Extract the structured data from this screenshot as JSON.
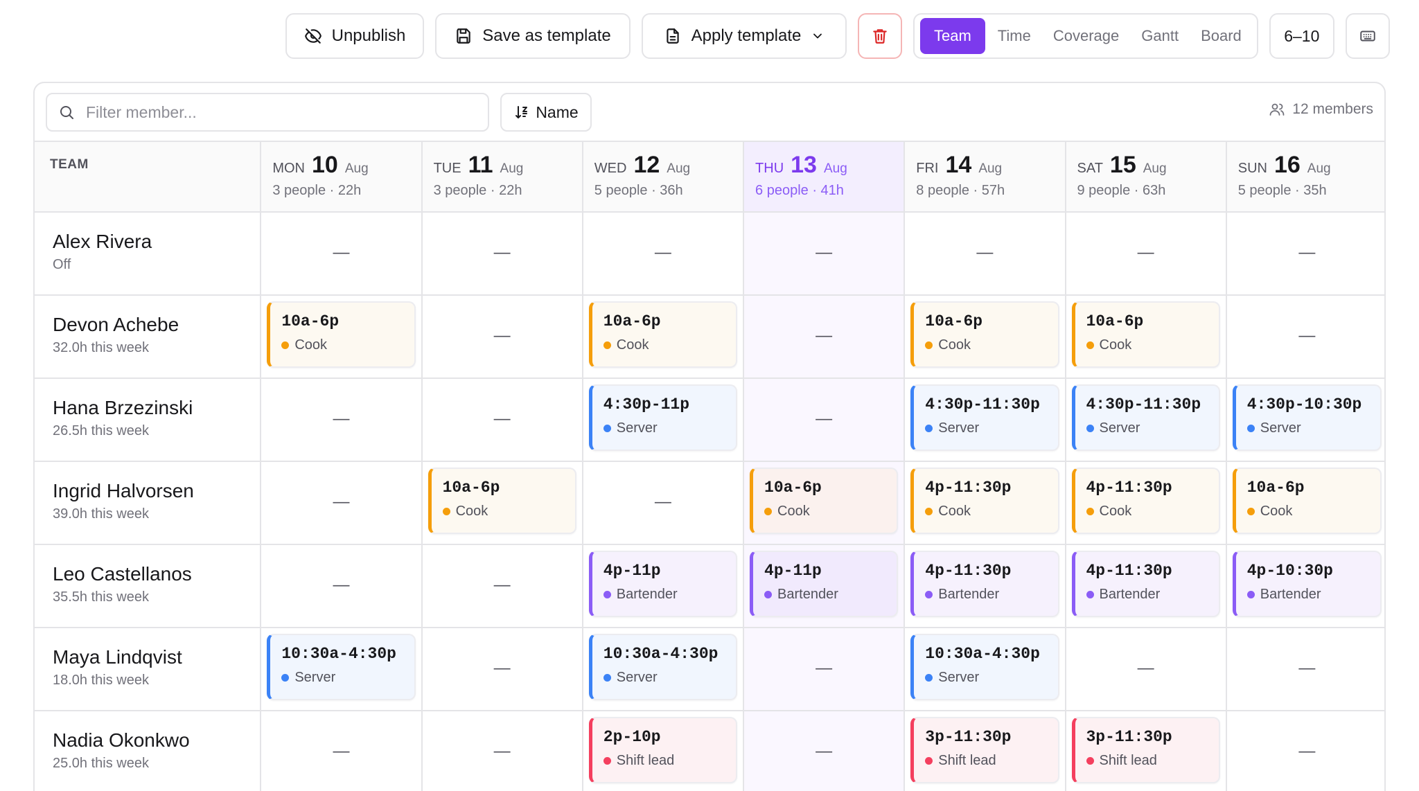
{
  "toolbar": {
    "unpublish_label": "Unpublish",
    "save_template_label": "Save as template",
    "apply_template_label": "Apply template",
    "view_tabs": [
      "Team",
      "Time",
      "Coverage",
      "Gantt",
      "Board"
    ],
    "active_view": "Team",
    "hours_label": "6–10",
    "icons": {
      "unpublish": "eye-off-icon",
      "save": "floppy-disk-icon",
      "apply": "document-icon",
      "apply_caret": "chevron-down-icon",
      "delete": "trash-icon",
      "keyboard": "keyboard-icon"
    }
  },
  "filter": {
    "placeholder": "Filter member...",
    "sort_label": "Name",
    "member_count": "12 members"
  },
  "grid": {
    "team_header": "TEAM",
    "days": [
      {
        "dow": "MON",
        "num": "10",
        "month": "Aug",
        "summary": "3 people · 22h",
        "today": false
      },
      {
        "dow": "TUE",
        "num": "11",
        "month": "Aug",
        "summary": "3 people · 22h",
        "today": false
      },
      {
        "dow": "WED",
        "num": "12",
        "month": "Aug",
        "summary": "5 people · 36h",
        "today": false
      },
      {
        "dow": "THU",
        "num": "13",
        "month": "Aug",
        "summary": "6 people · 41h",
        "today": true
      },
      {
        "dow": "FRI",
        "num": "14",
        "month": "Aug",
        "summary": "8 people · 57h",
        "today": false
      },
      {
        "dow": "SAT",
        "num": "15",
        "month": "Aug",
        "summary": "9 people · 63h",
        "today": false
      },
      {
        "dow": "SUN",
        "num": "16",
        "month": "Aug",
        "summary": "5 people · 35h",
        "today": false
      }
    ],
    "empty_mark": "—",
    "members": [
      {
        "name": "Alex Rivera",
        "sub": "Off",
        "shifts": [
          null,
          null,
          null,
          null,
          null,
          null,
          null
        ]
      },
      {
        "name": "Devon Achebe",
        "sub": "32.0h this week",
        "shifts": [
          {
            "time": "10a-6p",
            "role": "Cook"
          },
          null,
          {
            "time": "10a-6p",
            "role": "Cook"
          },
          null,
          {
            "time": "10a-6p",
            "role": "Cook"
          },
          {
            "time": "10a-6p",
            "role": "Cook"
          },
          null
        ]
      },
      {
        "name": "Hana Brzezinski",
        "sub": "26.5h this week",
        "shifts": [
          null,
          null,
          {
            "time": "4:30p-11p",
            "role": "Server"
          },
          null,
          {
            "time": "4:30p-11:30p",
            "role": "Server"
          },
          {
            "time": "4:30p-11:30p",
            "role": "Server"
          },
          {
            "time": "4:30p-10:30p",
            "role": "Server"
          }
        ]
      },
      {
        "name": "Ingrid Halvorsen",
        "sub": "39.0h this week",
        "shifts": [
          null,
          {
            "time": "10a-6p",
            "role": "Cook"
          },
          null,
          {
            "time": "10a-6p",
            "role": "Cook"
          },
          {
            "time": "4p-11:30p",
            "role": "Cook"
          },
          {
            "time": "4p-11:30p",
            "role": "Cook"
          },
          {
            "time": "10a-6p",
            "role": "Cook"
          }
        ]
      },
      {
        "name": "Leo Castellanos",
        "sub": "35.5h this week",
        "shifts": [
          null,
          null,
          {
            "time": "4p-11p",
            "role": "Bartender"
          },
          {
            "time": "4p-11p",
            "role": "Bartender"
          },
          {
            "time": "4p-11:30p",
            "role": "Bartender"
          },
          {
            "time": "4p-11:30p",
            "role": "Bartender"
          },
          {
            "time": "4p-10:30p",
            "role": "Bartender"
          }
        ]
      },
      {
        "name": "Maya Lindqvist",
        "sub": "18.0h this week",
        "shifts": [
          {
            "time": "10:30a-4:30p",
            "role": "Server"
          },
          null,
          {
            "time": "10:30a-4:30p",
            "role": "Server"
          },
          null,
          {
            "time": "10:30a-4:30p",
            "role": "Server"
          },
          null,
          null
        ]
      },
      {
        "name": "Nadia Okonkwo",
        "sub": "25.0h this week",
        "shifts": [
          null,
          null,
          {
            "time": "2p-10p",
            "role": "Shift lead"
          },
          null,
          {
            "time": "3p-11:30p",
            "role": "Shift lead"
          },
          {
            "time": "3p-11:30p",
            "role": "Shift lead"
          },
          null
        ]
      }
    ]
  },
  "colors": {
    "accent": "#7c3aed",
    "cook": "#f59e0b",
    "server": "#3b82f6",
    "bartender": "#8b5cf6",
    "shift_lead": "#f43f5e",
    "delete_icon": "#dc2626"
  }
}
